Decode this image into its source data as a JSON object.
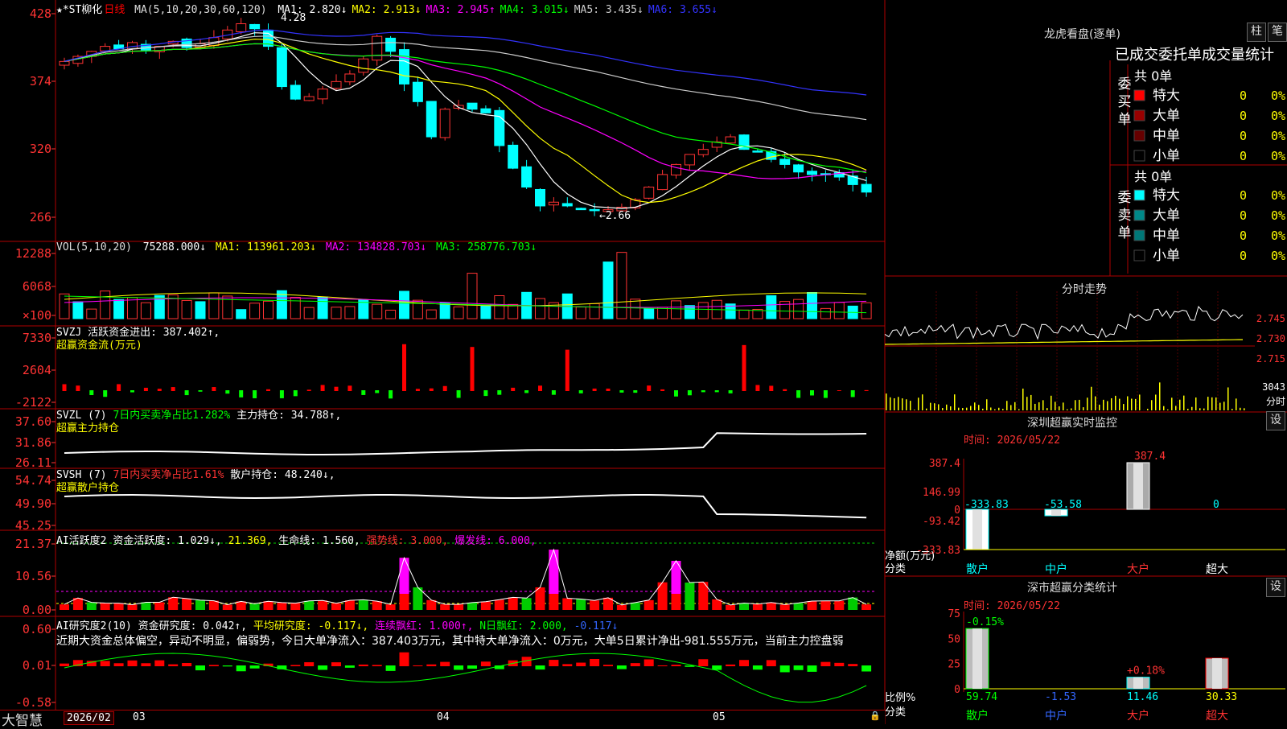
{
  "app": {
    "brand": "大智慧"
  },
  "kline": {
    "header": {
      "title": "★*ST柳化",
      "period": "日线",
      "ma_label": "MA(5,10,20,30,60,120)",
      "ma": [
        {
          "label": "MA1: 2.820↓",
          "color": "#ffffff"
        },
        {
          "label": "MA2: 2.913↓",
          "color": "#ffff00"
        },
        {
          "label": "MA3: 2.945↑",
          "color": "#ff00ff"
        },
        {
          "label": "MA4: 3.015↓",
          "color": "#00ff00"
        },
        {
          "label": "MA5: 3.435↓",
          "color": "#cccccc"
        },
        {
          "label": "MA6: 3.655↓",
          "color": "#3333ff"
        }
      ]
    },
    "yticks": [
      "428",
      "374",
      "320",
      "266"
    ],
    "hi_label": "4.28",
    "lo_label": "←2.66"
  },
  "vol": {
    "header": "VOL(5,10,20)",
    "v": "75288.000↓",
    "ma1": "MA1: 113961.203↓",
    "ma2": "MA2: 134828.703↓",
    "ma3": "MA3: 258776.703↓",
    "yticks": [
      "12288",
      "6068",
      "×100"
    ]
  },
  "svzj": {
    "header1": "SVZJ  活跃资金进出: 387.402↑,",
    "header2": "超赢资金流(万元)",
    "yticks": [
      "7330",
      "2604",
      "-2122"
    ]
  },
  "svzl": {
    "h_a": "SVZL (7)",
    "h_b": "7日内买卖净占比1.282%",
    "h_c": "主力持仓: 34.788↑,",
    "header2": "超赢主力持仓",
    "yticks": [
      "37.60",
      "31.86",
      "26.11"
    ]
  },
  "svsh": {
    "h_a": "SVSH (7)",
    "h_b": "7日内买卖净占比1.61%",
    "h_c": "散户持仓: 48.240↓,",
    "header2": "超赢散户持仓",
    "yticks": [
      "54.74",
      "49.90",
      "45.25"
    ]
  },
  "ai1": {
    "h_a": "AI活跃度2",
    "h_b": "资金活跃度: 1.029↓,",
    "h_c": "21.369,",
    "h_d": "生命线: 1.560,",
    "h_e": "强势线: 3.000,",
    "h_f": "爆发线: 6.000,",
    "yticks": [
      "21.37",
      "10.56",
      "0.00"
    ]
  },
  "ai2": {
    "h_a": "AI研究度2(10)",
    "h_b": "资金研究度: 0.042↑,",
    "h_c": "平均研究度: -0.117↓,",
    "h_d": "连续飘红: 1.000↑,",
    "h_e": "N日飘红: 2.000,",
    "h_f": "-0.117↓",
    "commentary": "近期大资金总体偏空，异动不明显，偏弱势，今日大单净流入：387.403万元，其中特大单净流入：0万元，大单5日累计净出-981.555万元，当前主力控盘弱",
    "yticks": [
      "0.60",
      "0.01",
      "-0.58"
    ]
  },
  "xaxis": [
    "2026/02",
    "03",
    "04",
    "05"
  ],
  "lhb": {
    "title": "龙虎看盘(逐单)",
    "btn1": "柱",
    "btn2": "笔",
    "subtitle": "已成交委托单成交量统计",
    "buy": {
      "side": "委买单",
      "total": "共 0单",
      "rows": [
        {
          "name": "特大",
          "v": "0",
          "p": "0%",
          "c": "#ff0000"
        },
        {
          "name": "大单",
          "v": "0",
          "p": "0%",
          "c": "#990000"
        },
        {
          "name": "中单",
          "v": "0",
          "p": "0%",
          "c": "#660000"
        },
        {
          "name": "小单",
          "v": "0",
          "p": "0%",
          "c": "#000000"
        }
      ]
    },
    "sell": {
      "side": "委卖单",
      "total": "共 0单",
      "rows": [
        {
          "name": "特大",
          "v": "0",
          "p": "0%",
          "c": "#00ffff"
        },
        {
          "name": "大单",
          "v": "0",
          "p": "0%",
          "c": "#008888"
        },
        {
          "name": "中单",
          "v": "0",
          "p": "0%",
          "c": "#007777"
        },
        {
          "name": "小单",
          "v": "0",
          "p": "0%",
          "c": "#000000"
        }
      ]
    }
  },
  "fs": {
    "title": "分时走势",
    "yticks": [
      "2.745",
      "2.730",
      "2.715",
      "3043",
      "分时"
    ]
  },
  "szmon": {
    "title": "深圳超赢实时监控",
    "btn": "设",
    "time": "时间: 2026/05/22",
    "ylabel": "净额(万元)",
    "xlabel": "分类",
    "yticks": [
      "387.4",
      "146.99",
      "0",
      "-93.42",
      "-333.83"
    ],
    "cats": [
      "散户",
      "中户",
      "大户",
      "超大"
    ],
    "values": [
      -333.83,
      -53.58,
      387.4,
      0
    ],
    "labels": [
      "-333.83",
      "-53.58",
      "387.4",
      "0"
    ]
  },
  "szstat": {
    "title": "深市超赢分类统计",
    "btn": "设",
    "time": "时间: 2026/05/22",
    "ylabel": "比例%",
    "xlabel": "分类",
    "yticks": [
      "75",
      "50",
      "25",
      "0"
    ],
    "cats": [
      "散户",
      "中户",
      "大户",
      "超大"
    ],
    "values": [
      59.74,
      -1.53,
      11.46,
      30.33
    ],
    "labels": [
      "59.74",
      "-1.53",
      "11.46",
      "30.33"
    ],
    "changes": [
      "-0.15%",
      "",
      "+0.18%",
      ""
    ]
  }
}
